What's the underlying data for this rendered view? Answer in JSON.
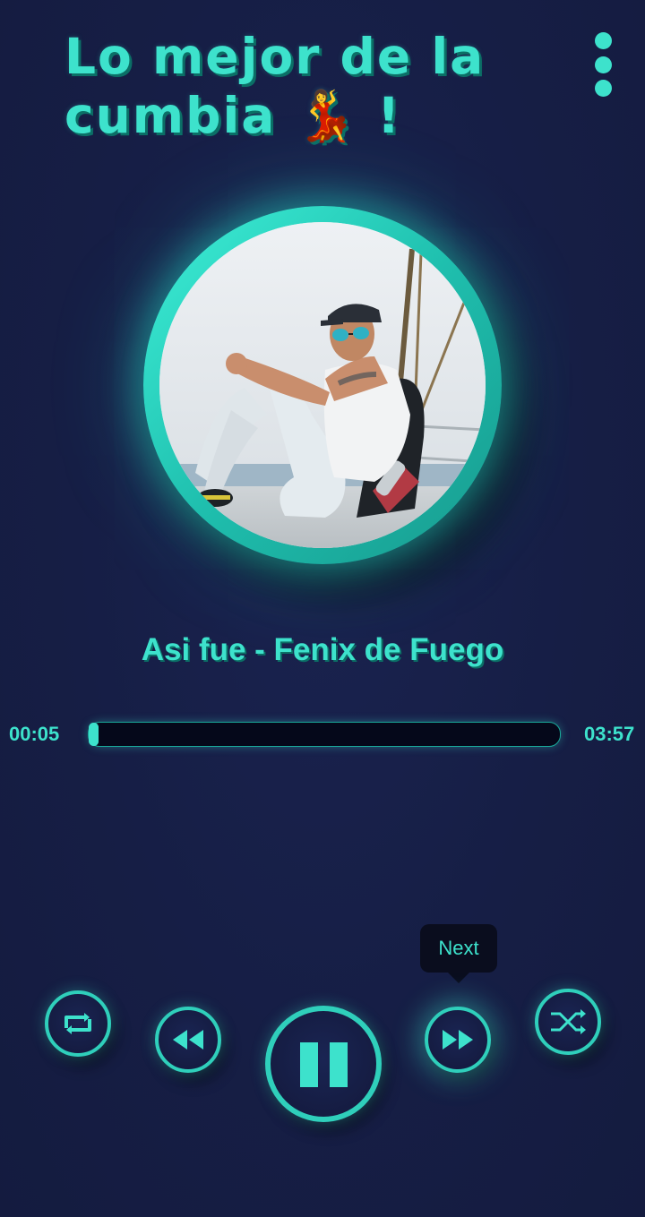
{
  "header": {
    "title": "Lo mejor de la cumbia 💃 !",
    "menu_icon": "more-vertical-icon"
  },
  "player": {
    "album_art_alt": "album-cover-photo",
    "song_title": "Asi fue - Fenix de Fuego",
    "current_time": "00:05",
    "total_time": "03:57",
    "progress": 0.02
  },
  "controls": {
    "repeat_icon": "repeat-icon",
    "previous_icon": "rewind-icon",
    "play_pause_icon": "pause-icon",
    "next_icon": "fast-forward-icon",
    "shuffle_icon": "shuffle-icon",
    "tooltip": "Next"
  },
  "colors": {
    "accent": "#3de2cc",
    "background": "#161e45",
    "track": "#05081a"
  }
}
